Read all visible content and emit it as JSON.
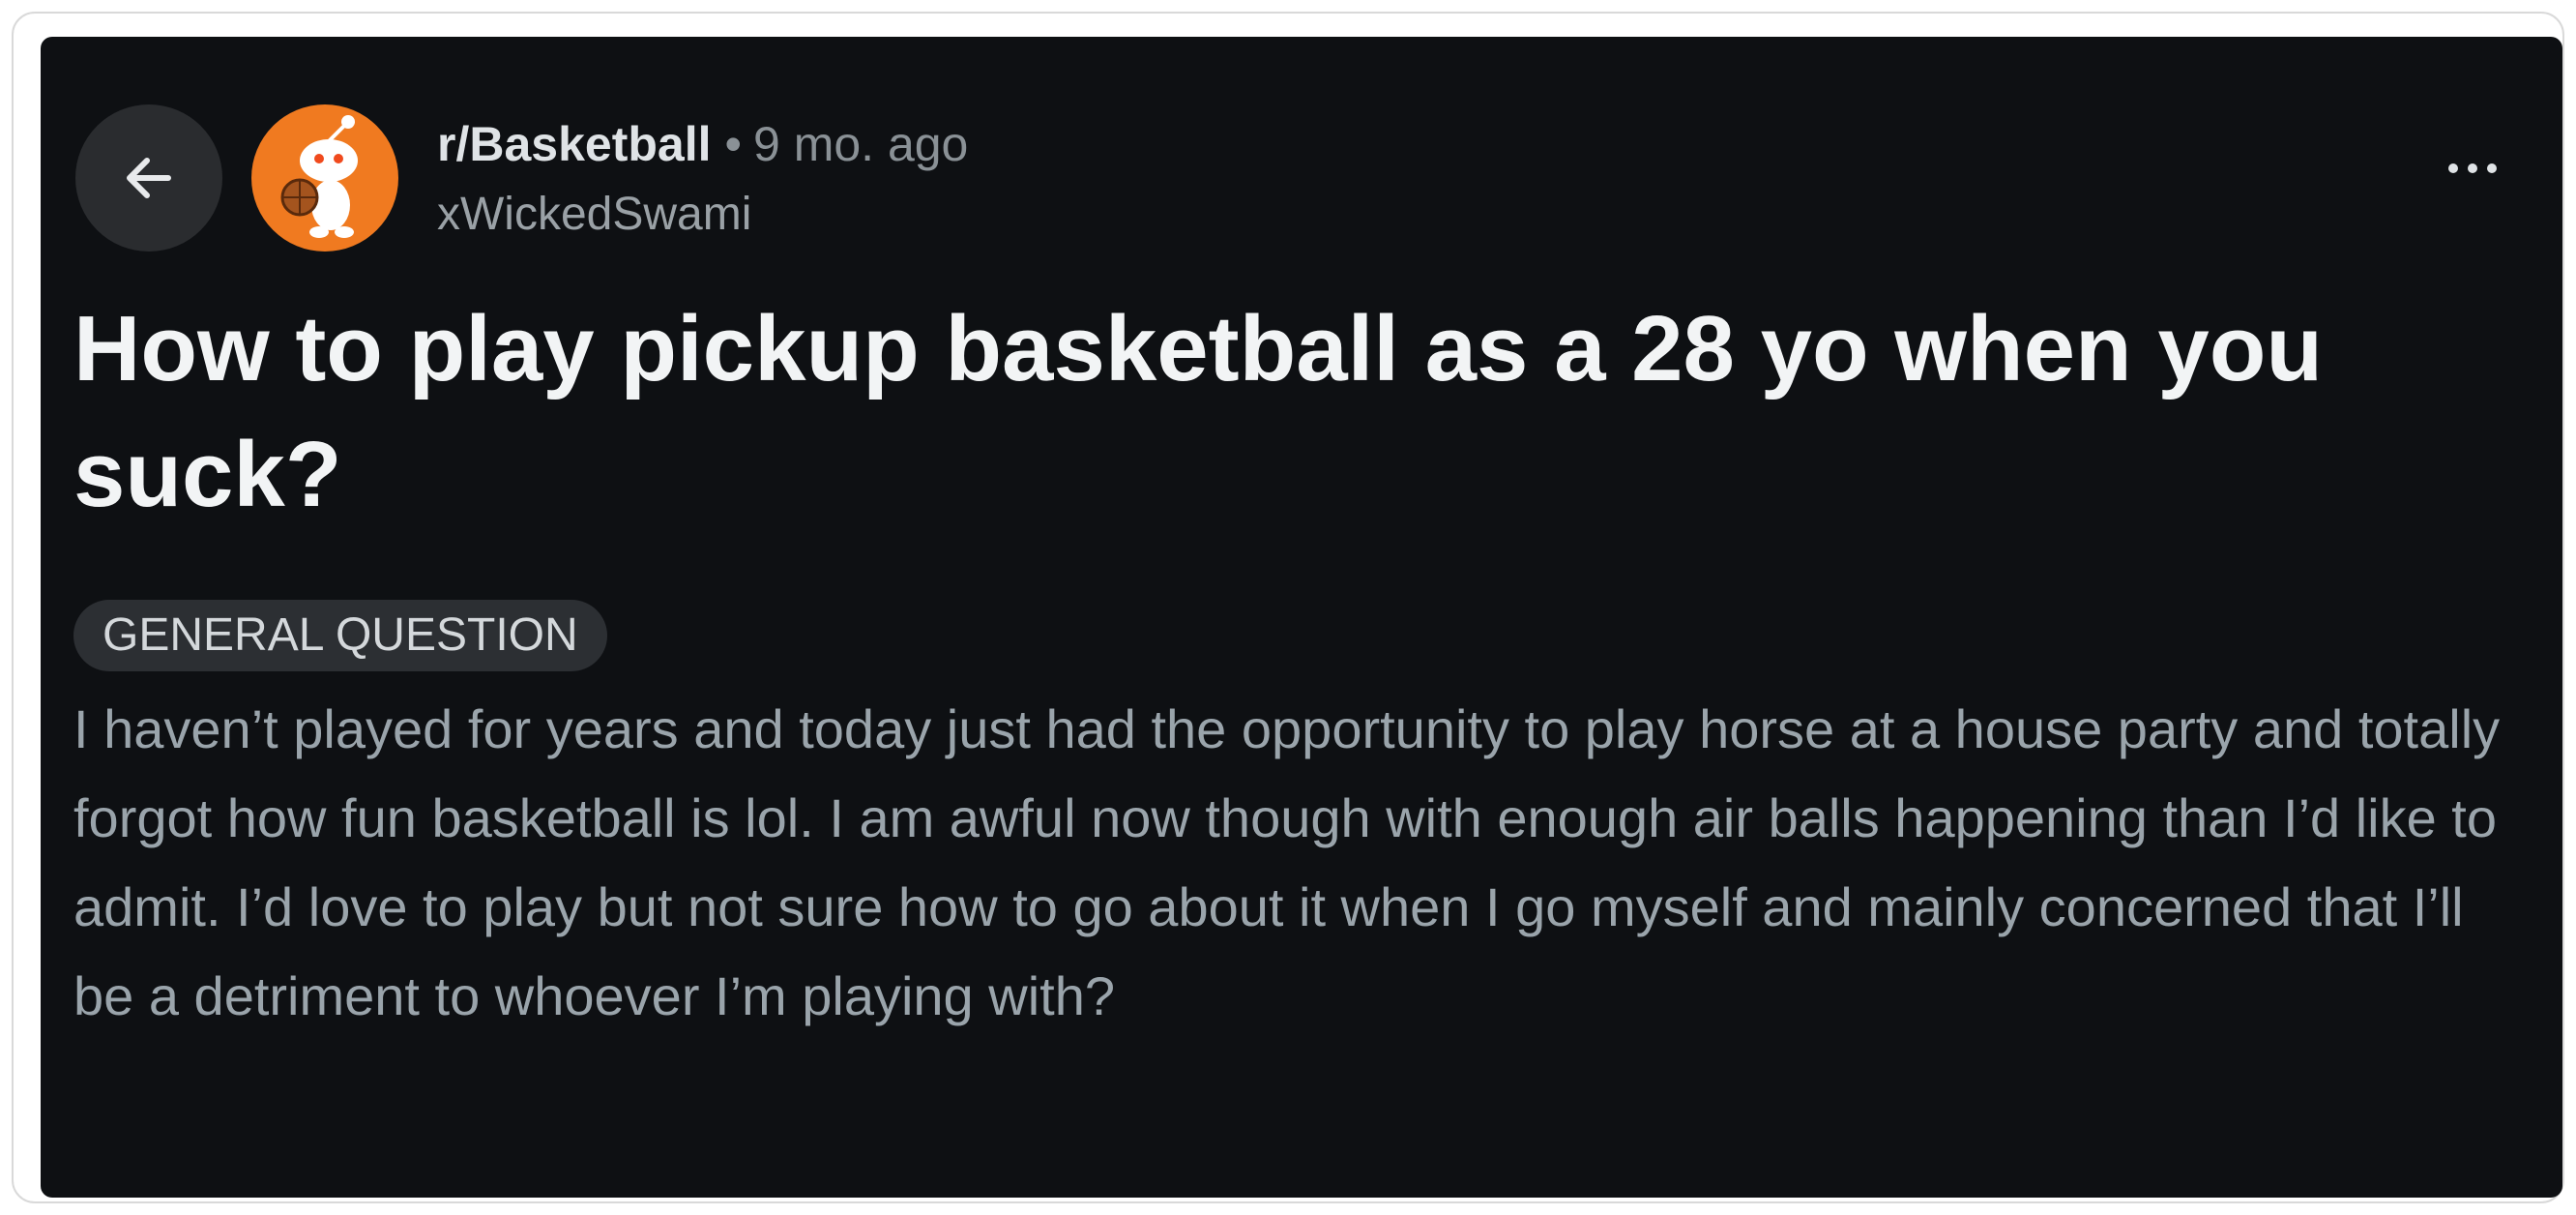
{
  "post": {
    "subreddit": "r/Basketball",
    "separator": "•",
    "time_ago": "9 mo. ago",
    "author": "xWickedSwami",
    "title": "How to play pickup basketball as a 28 yo when you suck?",
    "flair": "GENERAL QUESTION",
    "body": "I haven’t played for years and today just had the opportunity to play horse at a house party and totally forgot how fun basketball is lol. I am awful now though with enough air balls happening than I’d like to admit. I’d love to play but not sure how to go about it when I go myself and mainly concerned that I’ll be a detriment to whoever I’m playing with?"
  },
  "icons": {
    "back": "arrow-left-icon",
    "avatar": "subreddit-avatar-icon",
    "more": "more-options-icon"
  },
  "colors": {
    "background": "#0e1013",
    "avatar_bg": "#f07a20",
    "title": "#f2f4f5",
    "body_text": "#9aa4ab",
    "flair_bg": "#2c2f33"
  }
}
